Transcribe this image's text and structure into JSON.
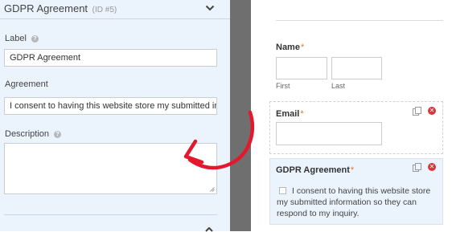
{
  "field_options": {
    "header_title": "GDPR Agreement",
    "header_id": "(ID #5)",
    "label_caption": "Label",
    "label_value": "GDPR Agreement",
    "agreement_caption": "Agreement",
    "agreement_value": "I consent to having this website store my submitted information so they can respond to my inquiry.",
    "description_caption": "Description",
    "description_value": ""
  },
  "preview": {
    "name_label": "Name",
    "first_label": "First",
    "last_label": "Last",
    "email_label": "Email",
    "gdpr_label": "GDPR Agreement",
    "gdpr_text": "I consent to having this website store my submitted information so they can respond to my inquiry.",
    "required_marker": "*"
  },
  "colors": {
    "panel_bg": "#ebf3fc",
    "gutter": "#6f6f6f",
    "annotation_arrow": "#e3182d",
    "required": "#e27730",
    "delete": "#d63638"
  },
  "icons": [
    "collapse-chevron-icon",
    "help-icon",
    "resize-grip-icon",
    "duplicate-icon",
    "delete-icon",
    "annotation-arrow"
  ]
}
